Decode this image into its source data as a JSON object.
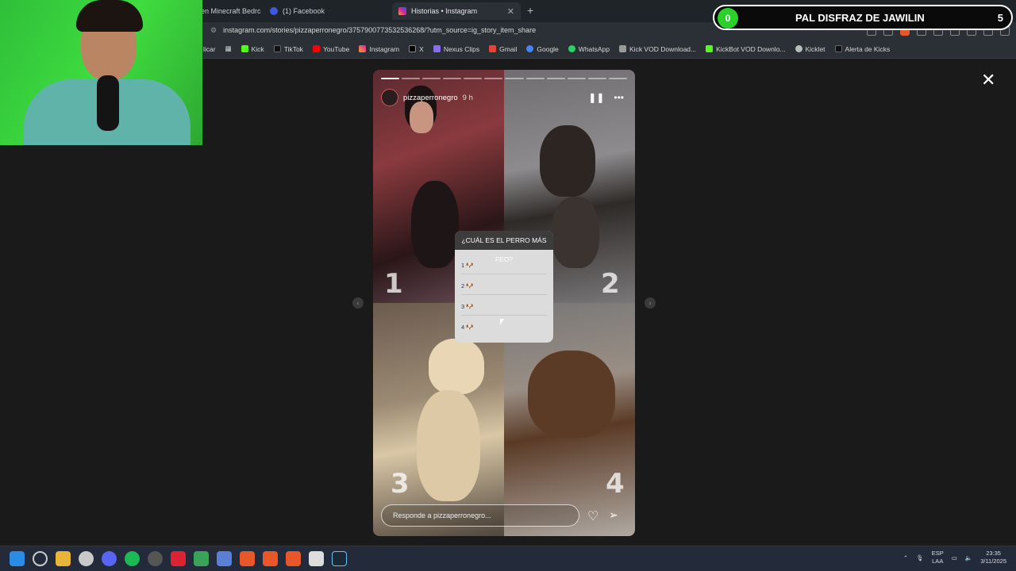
{
  "browser": {
    "tabs": [
      {
        "title": "en Minecraft Bedrc",
        "active": false
      },
      {
        "title": "(1) Facebook",
        "active": false
      },
      {
        "title": "Historias • Instagram",
        "active": true
      }
    ],
    "new_tab_label": "+",
    "url": "instagram.com/stories/pizzaperronegro/3757900773532536268/?utm_source=ig_story_item_share",
    "bookmarks": [
      "licar",
      "Kick",
      "TikTok",
      "YouTube",
      "Instagram",
      "X",
      "Nexus Clips",
      "Gmail",
      "Google",
      "WhatsApp",
      "Kick VOD Download...",
      "KickBot VOD Downlo...",
      "Kicklet",
      "Alerta de Kicks"
    ]
  },
  "story": {
    "username": "pizzaperronegro",
    "time_ago": "9 h",
    "progress_segments": 12,
    "progress_done": 1,
    "photo_numbers": [
      "1",
      "2",
      "3",
      "4"
    ],
    "poll": {
      "question": "¿CUÁL ES EL PERRO MÁS FEO?",
      "options": [
        "1 🐶",
        "2 🐶",
        "3 🐶",
        "4 🐶"
      ]
    },
    "reply_placeholder": "Responde a pizzaperronegro...",
    "close_label": "✕",
    "more_label": "•••",
    "pause_label": "❚❚",
    "prev_label": "‹",
    "next_label": "›",
    "like_icon": "♡",
    "send_icon": "➢"
  },
  "overlay": {
    "alert_count": "0",
    "alert_text": "PAL DISFRAZ DE JAWILIN",
    "alert_goal": "5"
  },
  "taskbar": {
    "language": "ESP",
    "language_sub": "LAA",
    "time": "23:35",
    "date": "3/11/2025"
  },
  "colors": {
    "accent_green": "#2ad12a",
    "brave_orange": "#e8572a"
  }
}
